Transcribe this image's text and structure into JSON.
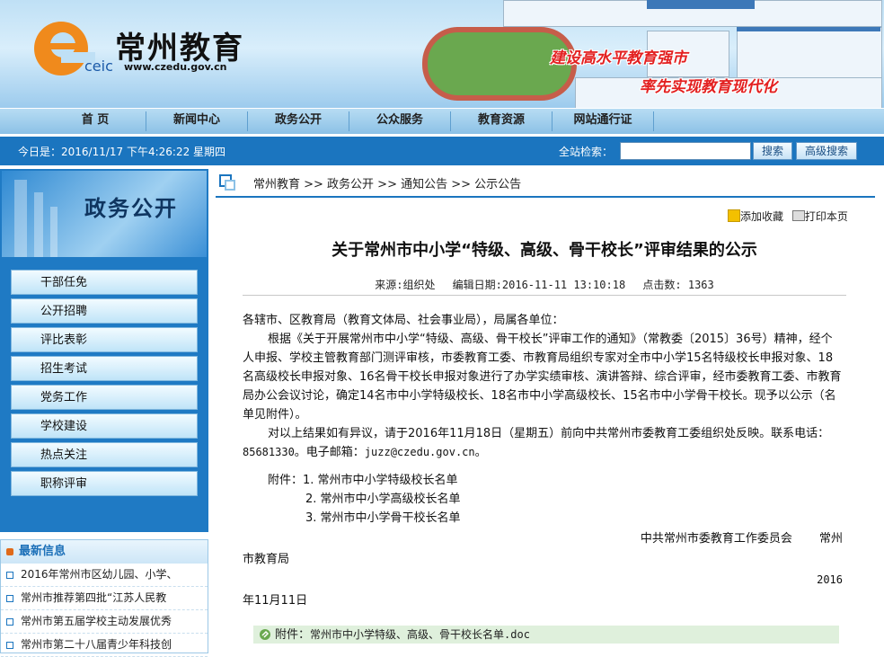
{
  "header": {
    "logo_cn": "常州教育",
    "logo_ceic": "ceic",
    "logo_url": "www.czedu.gov.cn",
    "slogan_1": "建设高水平教育强市",
    "slogan_2": "率先实现教育现代化"
  },
  "nav": {
    "items": [
      "首 页",
      "新闻中心",
      "政务公开",
      "公众服务",
      "教育资源",
      "网站通行证"
    ]
  },
  "datebar": {
    "today": "今日是：2016/11/17 下午4:26:22 星期四",
    "search_label": "全站检索：",
    "search_value": "",
    "search_button": "搜索",
    "advanced_button": "高级搜索"
  },
  "sidebar": {
    "title": "政务公开",
    "items": [
      "干部任免",
      "公开招聘",
      "评比表彰",
      "招生考试",
      "党务工作",
      "学校建设",
      "热点关注",
      "职称评审"
    ]
  },
  "news": {
    "title": "最新信息",
    "items": [
      "2016年常州市区幼儿园、小学、",
      "常州市推荐第四批“江苏人民教",
      "常州市第五届学校主动发展优秀",
      "常州市第二十八届青少年科技创"
    ]
  },
  "breadcrumb": "常州教育 >> 政务公开 >> 通知公告 >> 公示公告",
  "tools": {
    "favorite": "添加收藏",
    "print": "打印本页"
  },
  "article": {
    "title": "关于常州市中小学“特级、高级、骨干校长”评审结果的公示",
    "meta": "来源:组织处　 编辑日期:2016-11-11 13:10:18　 点击数: 1363",
    "salutation": "各辖市、区教育局（教育文体局、社会事业局），局属各单位：",
    "para1": "根据《关于开展常州市中小学“特级、高级、骨干校长”评审工作的通知》（常教委〔2015〕36号）精神，经个人申报、学校主管教育部门测评审核，市委教育工委、市教育局组织专家对全市中小学15名特级校长申报对象、18名高级校长申报对象、16名骨干校长申报对象进行了办学实绩审核、演讲答辩、综合评审，经市委教育工委、市教育局办公会议讨论，确定14名市中小学特级校长、18名市中小学高级校长、15名市中小学骨干校长。现予以公示（名单见附件）。",
    "para2_text": "对以上结果如有异议，请于2016年11月18日（星期五）前向中共常州市委教育工委组织处反映。联系电话：",
    "para2_phone": "85681330",
    "para2_mid": "。电子邮箱：",
    "para2_email": "juzz@czedu.gov.cn",
    "para2_end": "。",
    "attach_label": "附件：",
    "attachments": [
      "1. 常州市中小学特级校长名单",
      "2. 常州市中小学高级校长名单",
      "3. 常州市中小学骨干校长名单"
    ],
    "sign_org_1": "中共常州市委教育工作委员会　　 常州",
    "sign_org_2": "市教育局",
    "sign_year": "2016",
    "sign_date": "年11月11日",
    "download_label": "附件：",
    "download_file": "常州市中小学特级、高级、骨干校长名单.doc"
  },
  "colors": {
    "primary_blue": "#1b75bf",
    "slogan_red": "#e32020"
  }
}
